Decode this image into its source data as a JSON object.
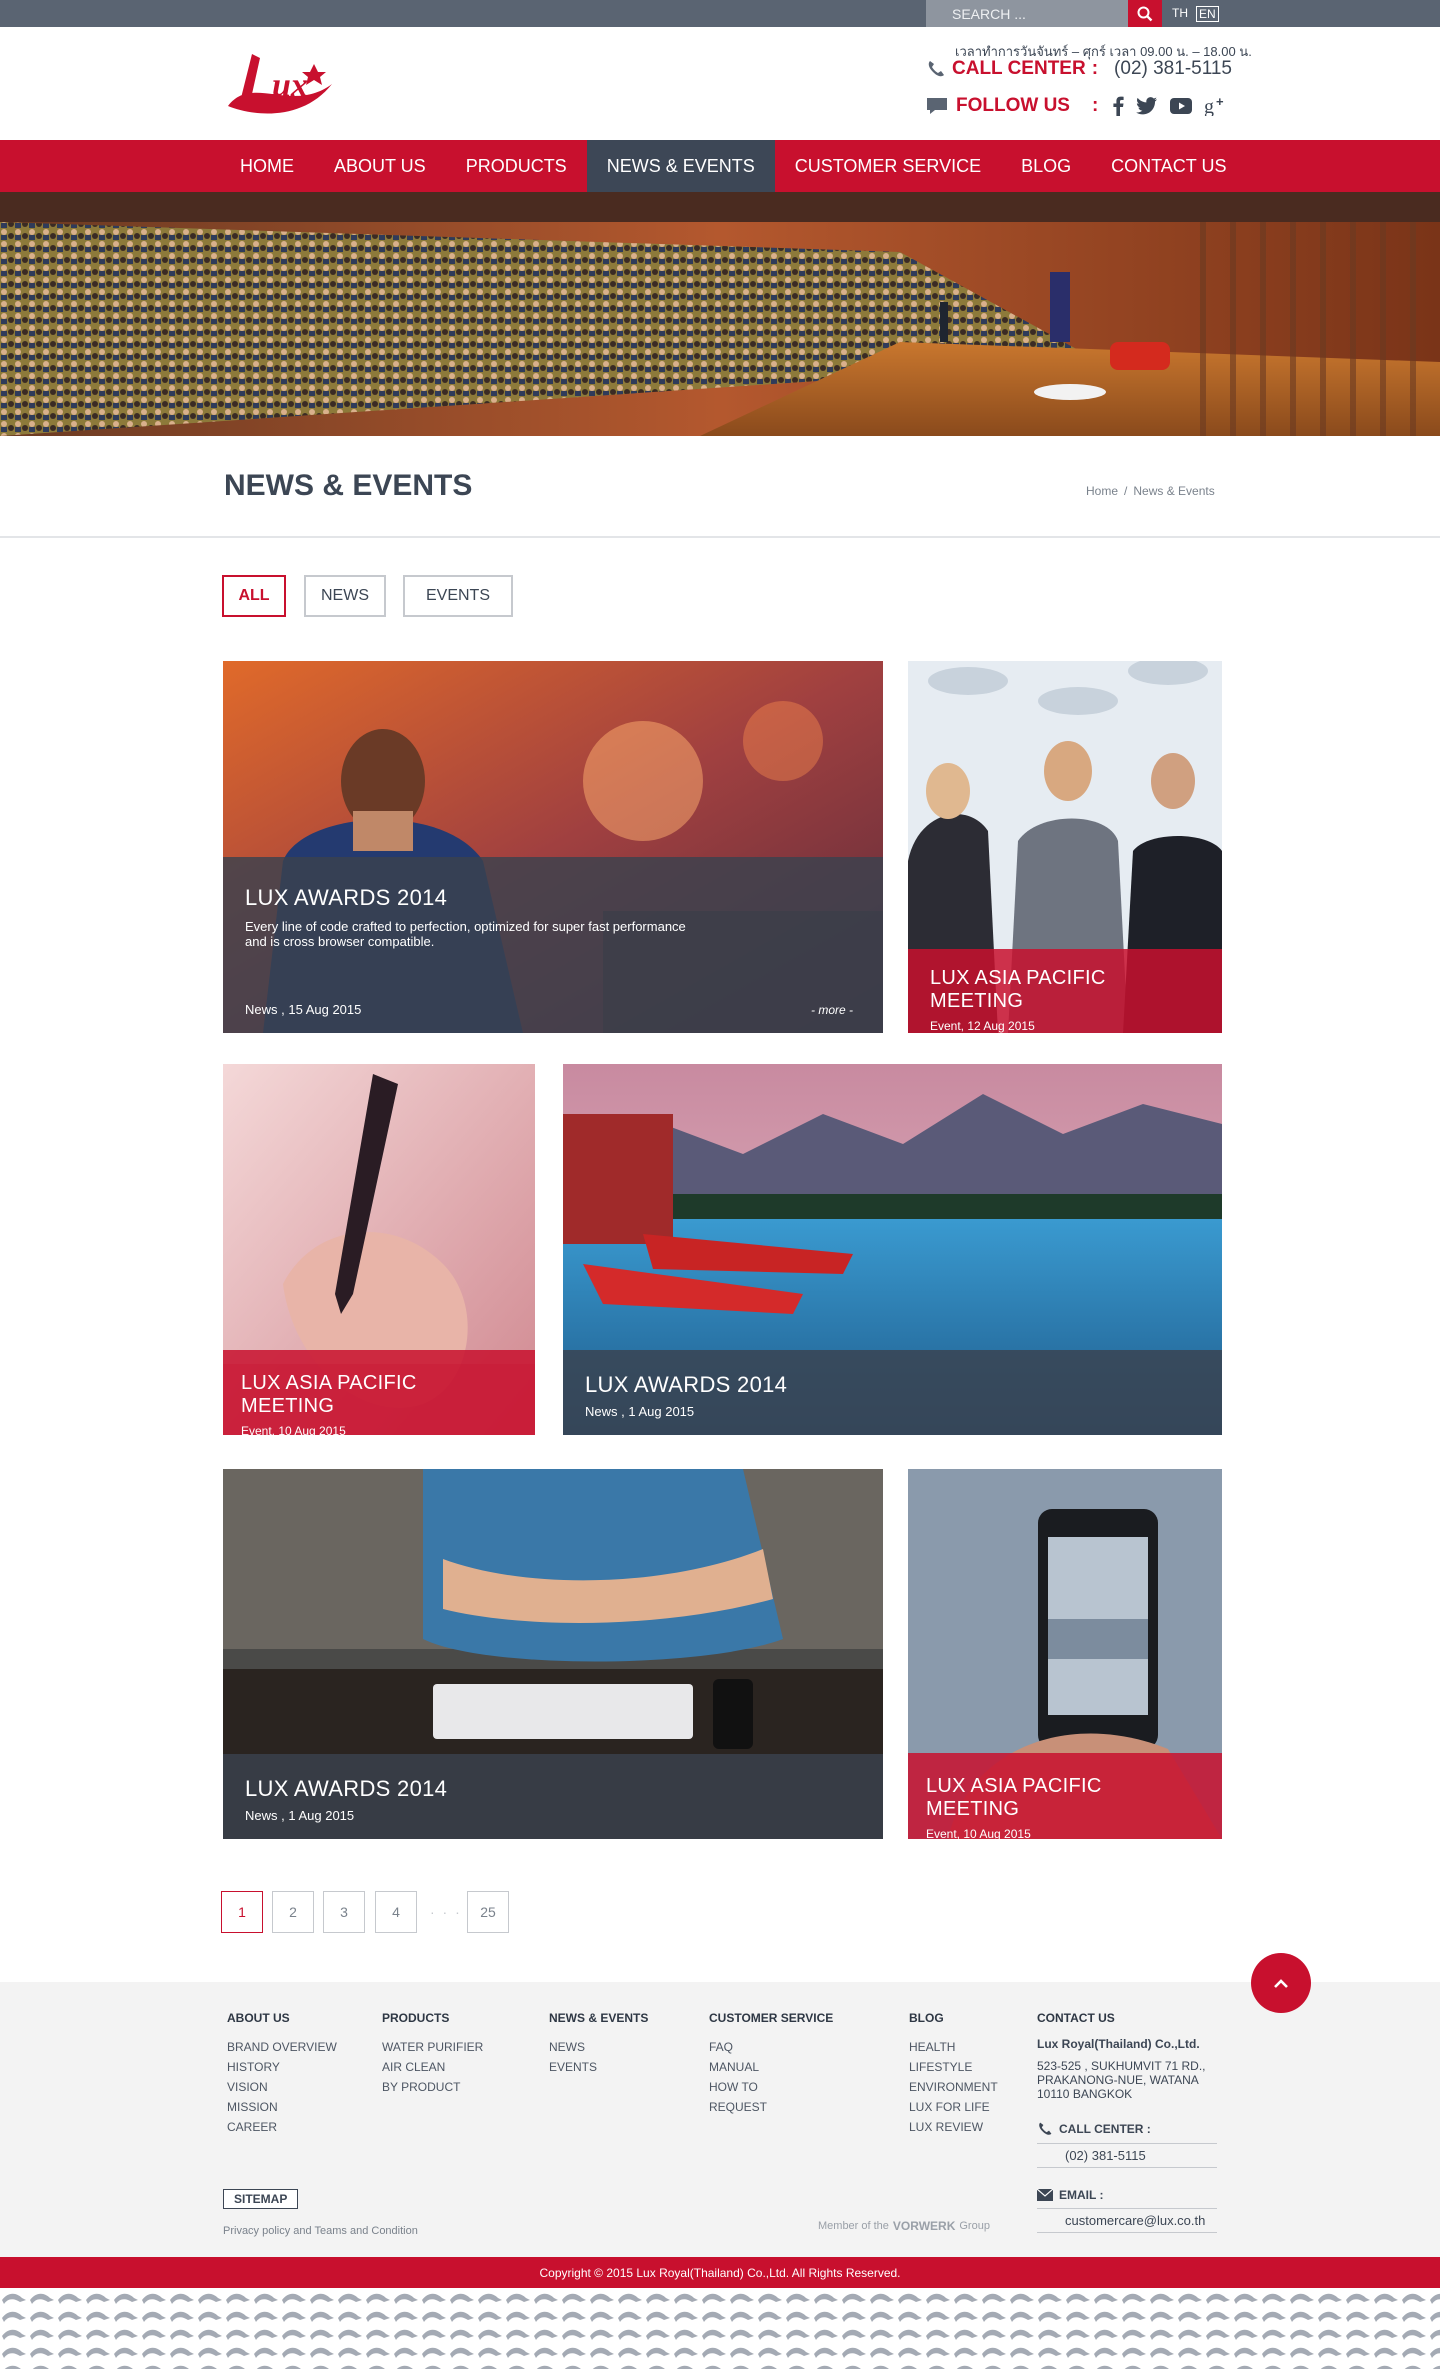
{
  "topbar": {
    "search_placeholder": "SEARCH ...",
    "lang_th": "TH",
    "lang_en": "EN"
  },
  "header": {
    "hours": "เวลาทำการวันจันทร์ – ศุกร์ เวลา 09.00 น. – 18.00 น.",
    "call_label": "CALL CENTER",
    "call_colon": ":",
    "call_number": "(02) 381-5115",
    "follow_label": "FOLLOW US",
    "follow_colon": ":",
    "logo_text": "LUX"
  },
  "nav": {
    "items": [
      "HOME",
      "ABOUT US",
      "PRODUCTS",
      "NEWS & EVENTS",
      "CUSTOMER SERVICE",
      "BLOG",
      "CONTACT US"
    ],
    "active": "NEWS & EVENTS"
  },
  "page": {
    "title": "NEWS & EVENTS",
    "crumb_home": "Home",
    "crumb_sep": "/",
    "crumb_current": "News & Events"
  },
  "filters": {
    "all": "ALL",
    "news": "NEWS",
    "events": "EVENTS",
    "active": "ALL"
  },
  "cards": [
    {
      "title": "LUX AWARDS 2014",
      "desc": "Every line of code crafted to perfection, optimized for super fast performance and is cross browser compatible.",
      "meta": "News ,  15  Aug  2015",
      "more": "- more -"
    },
    {
      "title": "LUX ASIA PACIFIC MEETING",
      "meta": "Event, 12  Aug  2015"
    },
    {
      "title": "LUX ASIA PACIFIC MEETING",
      "meta": "Event, 10 Aug  2015"
    },
    {
      "title": "LUX AWARDS 2014",
      "meta": "News ,  1 Aug  2015"
    },
    {
      "title": "LUX AWARDS 2014",
      "meta": "News ,  1 Aug  2015"
    },
    {
      "title": "LUX ASIA PACIFIC MEETING",
      "meta": "Event, 10 Aug  2015"
    }
  ],
  "pagination": {
    "pages": [
      "1",
      "2",
      "3",
      "4"
    ],
    "dots": "· · ·",
    "last": "25",
    "current": "1"
  },
  "footer": {
    "about": {
      "title": "ABOUT US",
      "items": [
        "BRAND OVERVIEW",
        "HISTORY",
        "VISION",
        "MISSION",
        "CAREER"
      ]
    },
    "products": {
      "title": "PRODUCTS",
      "items": [
        "WATER PURIFIER",
        "AIR CLEAN",
        "BY PRODUCT"
      ]
    },
    "news": {
      "title": "NEWS & EVENTS",
      "items": [
        "NEWS",
        "EVENTS"
      ]
    },
    "service": {
      "title": "CUSTOMER  SERVICE",
      "items": [
        "FAQ",
        "MANUAL",
        "HOW TO",
        "REQUEST"
      ]
    },
    "blog": {
      "title": "BLOG",
      "items": [
        "HEALTH",
        "LIFESTYLE",
        "ENVIRONMENT",
        "LUX FOR LIFE",
        "LUX REVIEW"
      ]
    },
    "contact": {
      "title": "CONTACT US",
      "company": "Lux Royal(Thailand) Co.,Ltd.",
      "address": "523-525 , SUKHUMVIT 71 RD., PRAKANONG-NUE, WATANA 10110 BANGKOK",
      "call_label": "CALL CENTER :",
      "call_value": "(02) 381-5115",
      "email_label": "EMAIL :",
      "email_value": "customercare@lux.co.th"
    },
    "sitemap": "SITEMAP",
    "privacy": "Privacy policy and Teams and Condition",
    "member_prefix": "Member of the",
    "member_brand": "VORWERK",
    "member_suffix": "Group",
    "copyright": "Copyright  © 2015  Lux Royal(Thailand) Co.,Ltd. All Rights Reserved."
  },
  "colors": {
    "brand_red": "#c8102e",
    "nav_active": "#3d4756",
    "text_dark": "#3c4654",
    "topbar": "#5a6472"
  },
  "icons": [
    "search-icon",
    "phone-icon",
    "chat-icon",
    "facebook-icon",
    "twitter-icon",
    "youtube-icon",
    "google-plus-icon",
    "arrow-up-icon",
    "mail-icon"
  ]
}
